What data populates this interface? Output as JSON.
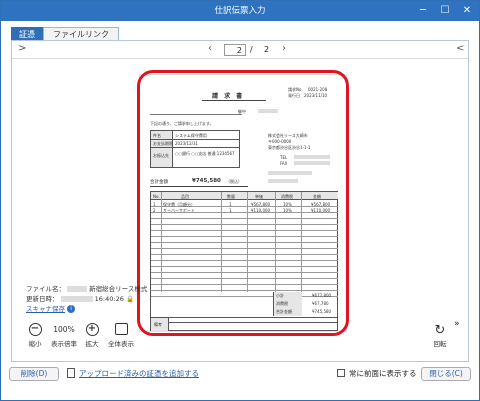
{
  "window": {
    "title": "仕訳伝票入力"
  },
  "tabs": [
    {
      "label": "証憑"
    },
    {
      "label": "ファイルリンク"
    }
  ],
  "pager": {
    "prev": ">",
    "next": "<",
    "current": "2",
    "slash": "/",
    "total": "2"
  },
  "invoice": {
    "title": "請 求 書",
    "no_label": "請求No.",
    "no": "0021-208",
    "date_label": "発行日",
    "date": "2023/11/10",
    "client_suffix": "御中",
    "greeting": "下記の通り、ご請求申し上げます。",
    "info_rows": [
      {
        "label": "件名",
        "value": "システム保守費用"
      },
      {
        "label": "お支払期限",
        "value": "2023/12/31"
      },
      {
        "label": "お振込先",
        "value": "○○銀行 ○○支店 普通 1234567"
      }
    ],
    "sender_lines": [
      "株式会社リース大崎市",
      "〒000-0000",
      "東京都渋谷区渋谷1-1-1",
      "TEL",
      "FAX"
    ],
    "total_label": "合計金額",
    "total_value": "¥745,580",
    "total_tax": "（税込）",
    "columns": [
      "No.",
      "品目",
      "数量",
      "単価",
      "消費税",
      "金額"
    ],
    "rows": [
      {
        "no": "1",
        "item": "保守費（月額分）",
        "qty": "1",
        "price": "¥567,800",
        "tax": "10%",
        "amount": "¥567,800"
      },
      {
        "no": "2",
        "item": "サーバーサポート",
        "qty": "1",
        "price": "¥110,000",
        "tax": "10%",
        "amount": "¥110,000"
      }
    ],
    "summary": [
      {
        "label": "小計",
        "value": "¥677,800"
      },
      {
        "label": "消費税",
        "value": "¥67,780"
      },
      {
        "label": "合計金額",
        "value": "¥745,580"
      }
    ],
    "remarks_label": "備考"
  },
  "meta": {
    "file_label": "ファイル名：",
    "file_value": "新宿総合リース株式",
    "updated_label": "更新日時：",
    "updated_value": "16:40:26",
    "scan_label": "スキャナ保存"
  },
  "tools": {
    "zoom_out": "縮小",
    "zoom_value": "100%",
    "zoom_rate_label": "表示倍率",
    "zoom_in": "拡大",
    "fit_all": "全体表示",
    "rotate": "回転"
  },
  "footer": {
    "delete": "削除(D)",
    "add_link": "アップロード済みの証憑を追加する",
    "always_front": "常に前面に表示する",
    "close": "閉じる(C)"
  },
  "colors": {
    "title_bar": "#2f73c0",
    "highlight": "#e0141e",
    "link": "#2a5ea8"
  }
}
